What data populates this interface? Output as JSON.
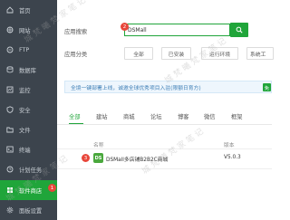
{
  "sidebar": {
    "items": [
      {
        "label": "首页",
        "icon": "home-icon"
      },
      {
        "label": "网站",
        "icon": "globe-icon"
      },
      {
        "label": "FTP",
        "icon": "ftp-icon"
      },
      {
        "label": "数据库",
        "icon": "database-icon"
      },
      {
        "label": "监控",
        "icon": "monitor-icon"
      },
      {
        "label": "安全",
        "icon": "shield-icon"
      },
      {
        "label": "文件",
        "icon": "folder-icon"
      },
      {
        "label": "终端",
        "icon": "terminal-icon"
      },
      {
        "label": "计划任务",
        "icon": "clock-icon"
      },
      {
        "label": "软件商店",
        "icon": "store-icon"
      },
      {
        "label": "面板设置",
        "icon": "gear-icon"
      }
    ],
    "active_index": 9,
    "active_color": "#20a53a"
  },
  "search": {
    "label": "应用搜索",
    "value": "DSMall"
  },
  "categories": {
    "label": "应用分类",
    "items": [
      "全部",
      "已安装",
      "运行环境",
      "系统工"
    ]
  },
  "notice": {
    "text": "全境一键部署上线，诚邀全球优秀项目入驻(限额日育方)",
    "tag": "免"
  },
  "tabs": {
    "items": [
      "全部",
      "建站",
      "商城",
      "论坛",
      "博客",
      "微信",
      "框架"
    ],
    "active_index": 0
  },
  "table": {
    "headers": {
      "name": "名称",
      "version": "版本"
    },
    "rows": [
      {
        "icon_text": "DS",
        "name": "DSMall多店铺B2B2C商城",
        "version": "V5.0.3"
      }
    ]
  },
  "annotations": [
    "1",
    "2",
    "3"
  ],
  "watermark": "城 梵 曦 梵 家 笔 记",
  "colors": {
    "accent": "#20a53a",
    "sidebar_bg": "#3c444d",
    "badge": "#e8463a"
  }
}
